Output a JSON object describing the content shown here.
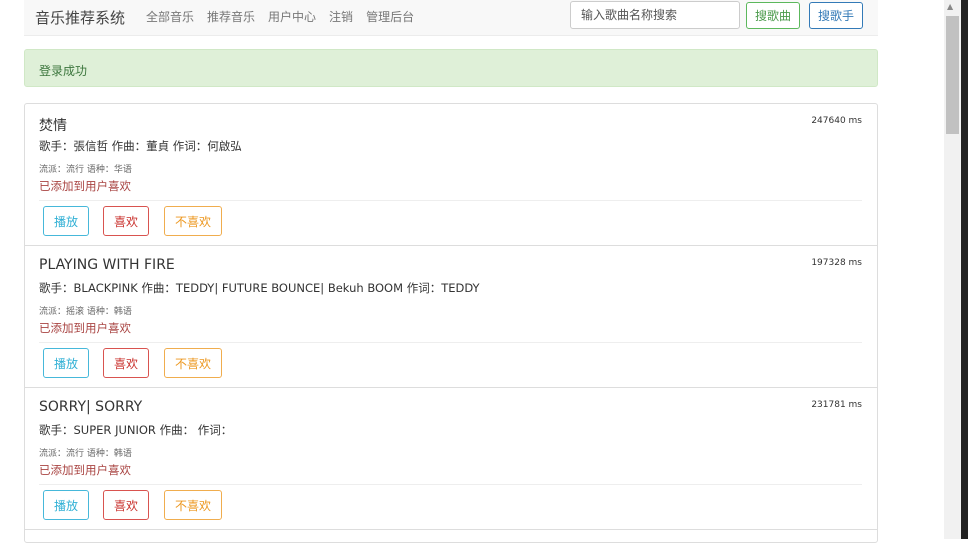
{
  "navbar": {
    "brand": "音乐推荐系统",
    "links": [
      "全部音乐",
      "推荐音乐",
      "用户中心",
      "注销",
      "管理后台"
    ],
    "search_placeholder": "输入歌曲名称搜索",
    "search_song_label": "搜歌曲",
    "search_singer_label": "搜歌手"
  },
  "alert": {
    "message": "登录成功"
  },
  "songs": [
    {
      "title": "焚情",
      "duration": "247640 ms",
      "credits": "歌手：張信哲 作曲：董貞 作词：何啟弘",
      "meta": "流派：流行 语种：华语",
      "added": "已添加到用户喜欢",
      "play_label": "播放",
      "like_label": "喜欢",
      "dislike_label": "不喜欢"
    },
    {
      "title": "PLAYING WITH FIRE",
      "duration": "197328 ms",
      "credits": "歌手：BLACKPINK 作曲：TEDDY| FUTURE BOUNCE| Bekuh BOOM 作词：TEDDY",
      "meta": "流派：摇滚 语种：韩语",
      "added": "已添加到用户喜欢",
      "play_label": "播放",
      "like_label": "喜欢",
      "dislike_label": "不喜欢"
    },
    {
      "title": "SORRY| SORRY",
      "duration": "231781 ms",
      "credits": "歌手：SUPER JUNIOR 作曲： 作词：",
      "meta": "流派：流行 语种：韩语",
      "added": "已添加到用户喜欢",
      "play_label": "播放",
      "like_label": "喜欢",
      "dislike_label": "不喜欢"
    }
  ],
  "scrollbar": {
    "up_arrow": "▲"
  }
}
